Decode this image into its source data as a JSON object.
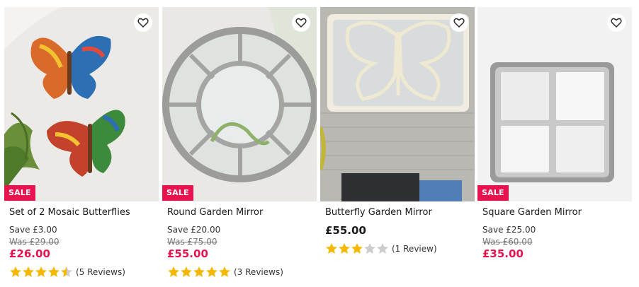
{
  "colors": {
    "sale": "#e6134f",
    "star": "#f5b800",
    "star_empty": "#cccccc"
  },
  "products": [
    {
      "title": "Set of 2 Mosaic Butterflies",
      "badge": "SALE",
      "save": "Save £3.00",
      "was": "Was £29.00",
      "price": "£26.00",
      "rating": 4.5,
      "reviews": "(5 Reviews)",
      "wishlist_icon": "heart-outline-icon"
    },
    {
      "title": "Round Garden Mirror",
      "badge": "SALE",
      "save": "Save £20.00",
      "was": "Was £75.00",
      "price": "£55.00",
      "rating": 5,
      "reviews": "(3 Reviews)",
      "wishlist_icon": "heart-outline-icon"
    },
    {
      "title": "Butterfly Garden Mirror",
      "price": "£55.00",
      "rating": 3,
      "reviews": "(1 Review)",
      "wishlist_icon": "heart-outline-icon"
    },
    {
      "title": "Square Garden Mirror",
      "badge": "SALE",
      "save": "Save £25.00",
      "was": "Was £60.00",
      "price": "£35.00",
      "wishlist_icon": "heart-outline-icon"
    }
  ]
}
